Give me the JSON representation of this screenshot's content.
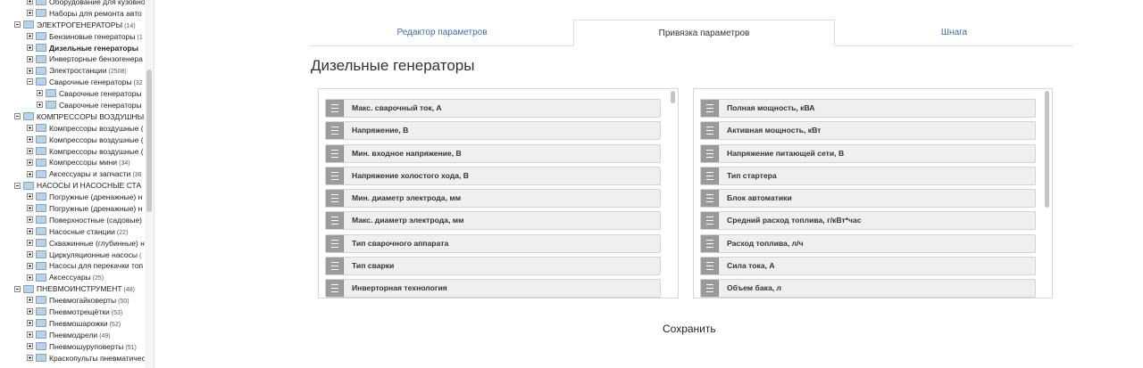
{
  "sidebar": {
    "items": [
      {
        "level": 1,
        "toggle": "plus",
        "label": "Оборудование для кузовно",
        "count": "",
        "bold": false
      },
      {
        "level": 1,
        "toggle": "plus",
        "label": "Наборы для ремонта авто",
        "count": "",
        "bold": false
      },
      {
        "level": 0,
        "toggle": "minus",
        "label": "ЭЛЕКТРОГЕНЕРАТОРЫ",
        "count": "(14)",
        "bold": false
      },
      {
        "level": 1,
        "toggle": "plus",
        "label": "Бензиновые генераторы",
        "count": "(1",
        "bold": false
      },
      {
        "level": 1,
        "toggle": "plus",
        "label": "Дизельные генераторы",
        "count": "",
        "bold": true
      },
      {
        "level": 1,
        "toggle": "plus",
        "label": "Инверторные бензогенера",
        "count": "",
        "bold": false
      },
      {
        "level": 1,
        "toggle": "plus",
        "label": "Электростанции",
        "count": "(2508)",
        "bold": false
      },
      {
        "level": 1,
        "toggle": "minus",
        "label": "Сварочные генераторы",
        "count": "(32",
        "bold": false
      },
      {
        "level": 2,
        "toggle": "plus",
        "label": "Сварочные генераторы",
        "count": "",
        "bold": false
      },
      {
        "level": 2,
        "toggle": "plus",
        "label": "Сварочные генераторы",
        "count": "",
        "bold": false
      },
      {
        "level": 0,
        "toggle": "minus",
        "label": "КОМПРЕССОРЫ ВОЗДУШНЫ",
        "count": "",
        "bold": false
      },
      {
        "level": 1,
        "toggle": "plus",
        "label": "Компрессоры воздушные (",
        "count": "",
        "bold": false
      },
      {
        "level": 1,
        "toggle": "plus",
        "label": "Компрессоры воздушные (",
        "count": "",
        "bold": false
      },
      {
        "level": 1,
        "toggle": "plus",
        "label": "Компрессоры воздушные (",
        "count": "",
        "bold": false
      },
      {
        "level": 1,
        "toggle": "plus",
        "label": "Компрессоры мини",
        "count": "(34)",
        "bold": false
      },
      {
        "level": 1,
        "toggle": "plus",
        "label": "Аксессуары и запчасти",
        "count": "(36",
        "bold": false
      },
      {
        "level": 0,
        "toggle": "minus",
        "label": "НАСОСЫ И НАСОСНЫЕ СТА",
        "count": "",
        "bold": false
      },
      {
        "level": 1,
        "toggle": "plus",
        "label": "Погружные (дренажные) н",
        "count": "",
        "bold": false
      },
      {
        "level": 1,
        "toggle": "plus",
        "label": "Погружные (дренажные) н",
        "count": "",
        "bold": false
      },
      {
        "level": 1,
        "toggle": "plus",
        "label": "Поверхностные (садовые)",
        "count": "",
        "bold": false
      },
      {
        "level": 1,
        "toggle": "plus",
        "label": "Насосные станции",
        "count": "(22)",
        "bold": false
      },
      {
        "level": 1,
        "toggle": "plus",
        "label": "Скважинные (глубинные) н",
        "count": "",
        "bold": false
      },
      {
        "level": 1,
        "toggle": "plus",
        "label": "Циркуляционные насосы",
        "count": "(",
        "bold": false
      },
      {
        "level": 1,
        "toggle": "plus",
        "label": "Насосы для перекачки топ",
        "count": "",
        "bold": false
      },
      {
        "level": 1,
        "toggle": "plus",
        "label": "Аксессуары",
        "count": "(25)",
        "bold": false
      },
      {
        "level": 0,
        "toggle": "minus",
        "label": "ПНЕВМОИНСТРУМЕНТ",
        "count": "(48)",
        "bold": false
      },
      {
        "level": 1,
        "toggle": "plus",
        "label": "Пневмогайковерты",
        "count": "(50)",
        "bold": false
      },
      {
        "level": 1,
        "toggle": "plus",
        "label": "Пневмотрещётки",
        "count": "(53)",
        "bold": false
      },
      {
        "level": 1,
        "toggle": "plus",
        "label": "Пневмошарожки",
        "count": "(52)",
        "bold": false
      },
      {
        "level": 1,
        "toggle": "plus",
        "label": "Пневмодрели",
        "count": "(49)",
        "bold": false
      },
      {
        "level": 1,
        "toggle": "plus",
        "label": "Пневмошуруповерты",
        "count": "(51)",
        "bold": false
      },
      {
        "level": 1,
        "toggle": "plus",
        "label": "Краскопульты пневматичес",
        "count": "",
        "bold": false
      }
    ]
  },
  "tabs": [
    {
      "label": "Редактор параметров",
      "active": false
    },
    {
      "label": "Привязка параметров",
      "active": true
    },
    {
      "label": "Шнага",
      "active": false
    }
  ],
  "page_title": "Дизельные генераторы",
  "left_list": [
    "Макс. сварочный ток, А",
    "Напряжение, В",
    "Мин. входное напряжение, В",
    "Напряжение холостого хода, В",
    "Мин. диаметр электрода, мм",
    "Макс. диаметр электрода, мм",
    "Тип сварочного аппарата",
    "Тип сварки",
    "Инверторная технология"
  ],
  "right_list": [
    "Полная мощность, кВА",
    "Активная мощность, кВт",
    "Напряжение питающей сети, В",
    "Тип стартера",
    "Блок автоматики",
    "Средний расход топлива, г/кВт*час",
    "Расход топлива, л/ч",
    "Сила тока, А",
    "Объем бака, л"
  ],
  "save_label": "Сохранить",
  "icons": {
    "handle": "drag-handle-icon",
    "folder": "folder-icon",
    "toggle": "tree-toggle-icon"
  }
}
